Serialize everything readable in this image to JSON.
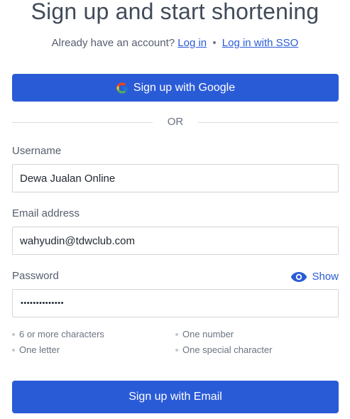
{
  "header": {
    "title": "Sign up and start shortening",
    "prompt": "Already have an account?",
    "login_link": "Log in",
    "separator": "•",
    "sso_link": "Log in with SSO"
  },
  "google_button": {
    "label": "Sign up with Google",
    "icon": "google-logo-icon"
  },
  "divider": {
    "label": "OR"
  },
  "form": {
    "username": {
      "label": "Username",
      "value": "Dewa Jualan Online"
    },
    "email": {
      "label": "Email address",
      "value": "wahyudin@tdwclub.com"
    },
    "password": {
      "label": "Password",
      "masked_value": "••••••••••••••",
      "show_label": "Show",
      "show_icon": "eye-icon"
    }
  },
  "requirements": [
    {
      "text": "6 or more characters"
    },
    {
      "text": "One number"
    },
    {
      "text": "One letter"
    },
    {
      "text": "One special character"
    }
  ],
  "submit": {
    "label": "Sign up with Email"
  },
  "colors": {
    "primary": "#2a5bd7",
    "text": "#414b5a",
    "muted": "#6b7482"
  }
}
